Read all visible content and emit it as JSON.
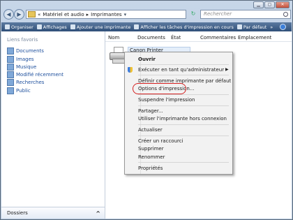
{
  "address": {
    "segments": [
      "«",
      "Matériel et audio",
      "▸",
      "Imprimantes"
    ],
    "search_placeholder": "Rechercher"
  },
  "window_controls": {
    "minimize": "▁",
    "maximize": "▢",
    "close": "✕"
  },
  "toolbar": {
    "items": [
      "Organiser",
      "Affichages",
      "Ajouter une imprimante",
      "Afficher les tâches d'impression en cours",
      "Par défaut",
      "»"
    ]
  },
  "sidebar": {
    "heading": "Liens favoris",
    "items": [
      "Documents",
      "Images",
      "Musique",
      "Modifié récemment",
      "Recherches",
      "Public"
    ],
    "footer": "Dossiers"
  },
  "columns": [
    "Nom",
    "Documents",
    "État",
    "Commentaires",
    "Emplacement"
  ],
  "printer": {
    "name": "Canon Printer"
  },
  "context_menu": {
    "items": [
      "Ouvrir",
      "Exécuter en tant qu'administrateur",
      "Définir comme imprimante par défaut",
      "Options d'impression...",
      "Suspendre l'impression",
      "Partager...",
      "Utiliser l'imprimante hors connexion",
      "Actualiser",
      "Créer un raccourci",
      "Supprimer",
      "Renommer",
      "Propriétés"
    ]
  },
  "colors": {
    "highlight_ring": "#d42020",
    "toolbar": "#2f4f78"
  }
}
